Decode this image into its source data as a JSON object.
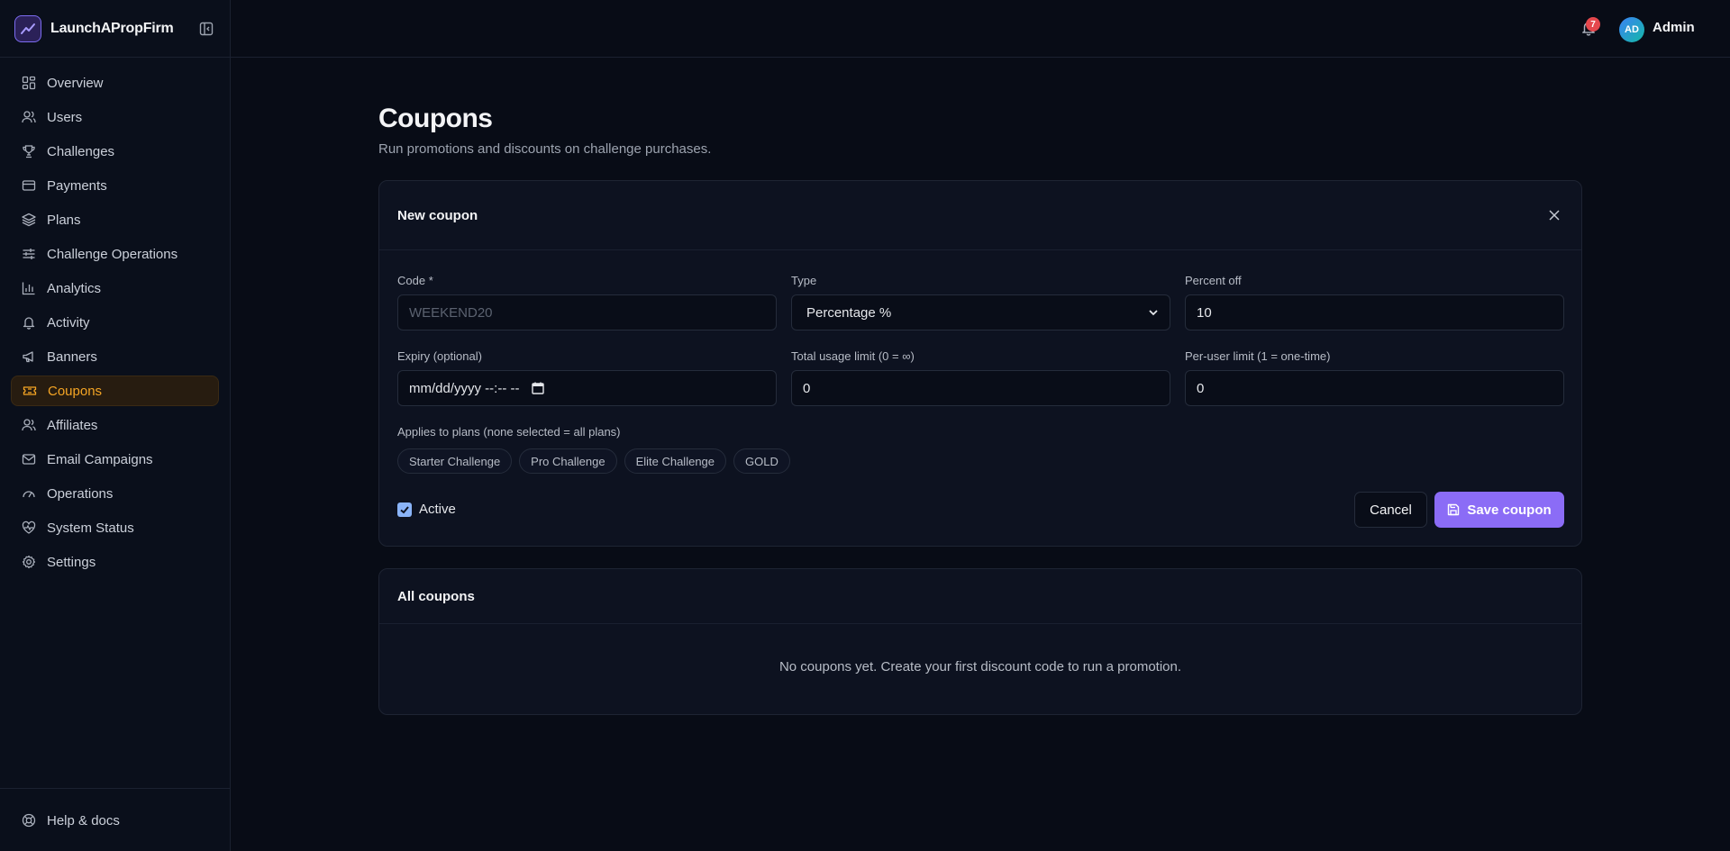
{
  "brand": {
    "name": "LaunchAPropFirm"
  },
  "sidebar": {
    "items": [
      {
        "label": "Overview",
        "icon": "grid-icon"
      },
      {
        "label": "Users",
        "icon": "users-icon"
      },
      {
        "label": "Challenges",
        "icon": "trophy-icon"
      },
      {
        "label": "Payments",
        "icon": "credit-card-icon"
      },
      {
        "label": "Plans",
        "icon": "layers-icon"
      },
      {
        "label": "Challenge Operations",
        "icon": "sliders-icon"
      },
      {
        "label": "Analytics",
        "icon": "bar-chart-icon"
      },
      {
        "label": "Activity",
        "icon": "bell-icon"
      },
      {
        "label": "Banners",
        "icon": "megaphone-icon"
      },
      {
        "label": "Coupons",
        "icon": "ticket-icon",
        "active": true
      },
      {
        "label": "Affiliates",
        "icon": "user-group-icon"
      },
      {
        "label": "Email Campaigns",
        "icon": "mail-icon"
      },
      {
        "label": "Operations",
        "icon": "gauge-icon"
      },
      {
        "label": "System Status",
        "icon": "heart-pulse-icon"
      },
      {
        "label": "Settings",
        "icon": "gear-icon"
      }
    ],
    "footer": {
      "label": "Help & docs",
      "icon": "help-icon"
    }
  },
  "topbar": {
    "notifications": "7",
    "avatar_initials": "AD",
    "user_name": "Admin"
  },
  "page": {
    "title": "Coupons",
    "subtitle": "Run promotions and discounts on challenge purchases."
  },
  "new_coupon": {
    "title": "New coupon",
    "code_label": "Code *",
    "code_placeholder": "WEEKEND20",
    "type_label": "Type",
    "type_value": "Percentage %",
    "percent_label": "Percent off",
    "percent_value": "10",
    "expiry_label": "Expiry (optional)",
    "expiry_placeholder": "mm/dd/yyyy --:-- --",
    "total_limit_label": "Total usage limit (0 = ∞)",
    "total_limit_value": "0",
    "per_user_label": "Per-user limit (1 = one-time)",
    "per_user_value": "0",
    "plans_label": "Applies to plans (none selected = all plans)",
    "plans": [
      "Starter Challenge",
      "Pro Challenge",
      "Elite Challenge",
      "GOLD"
    ],
    "active_label": "Active",
    "active_checked": true,
    "cancel_label": "Cancel",
    "save_label": "Save coupon"
  },
  "all_coupons": {
    "title": "All coupons",
    "empty_text": "No coupons yet. Create your first discount code to run a promotion."
  },
  "colors": {
    "accent": "#8b6cf6",
    "active_nav": "#f5a524",
    "badge": "#e5484d"
  }
}
